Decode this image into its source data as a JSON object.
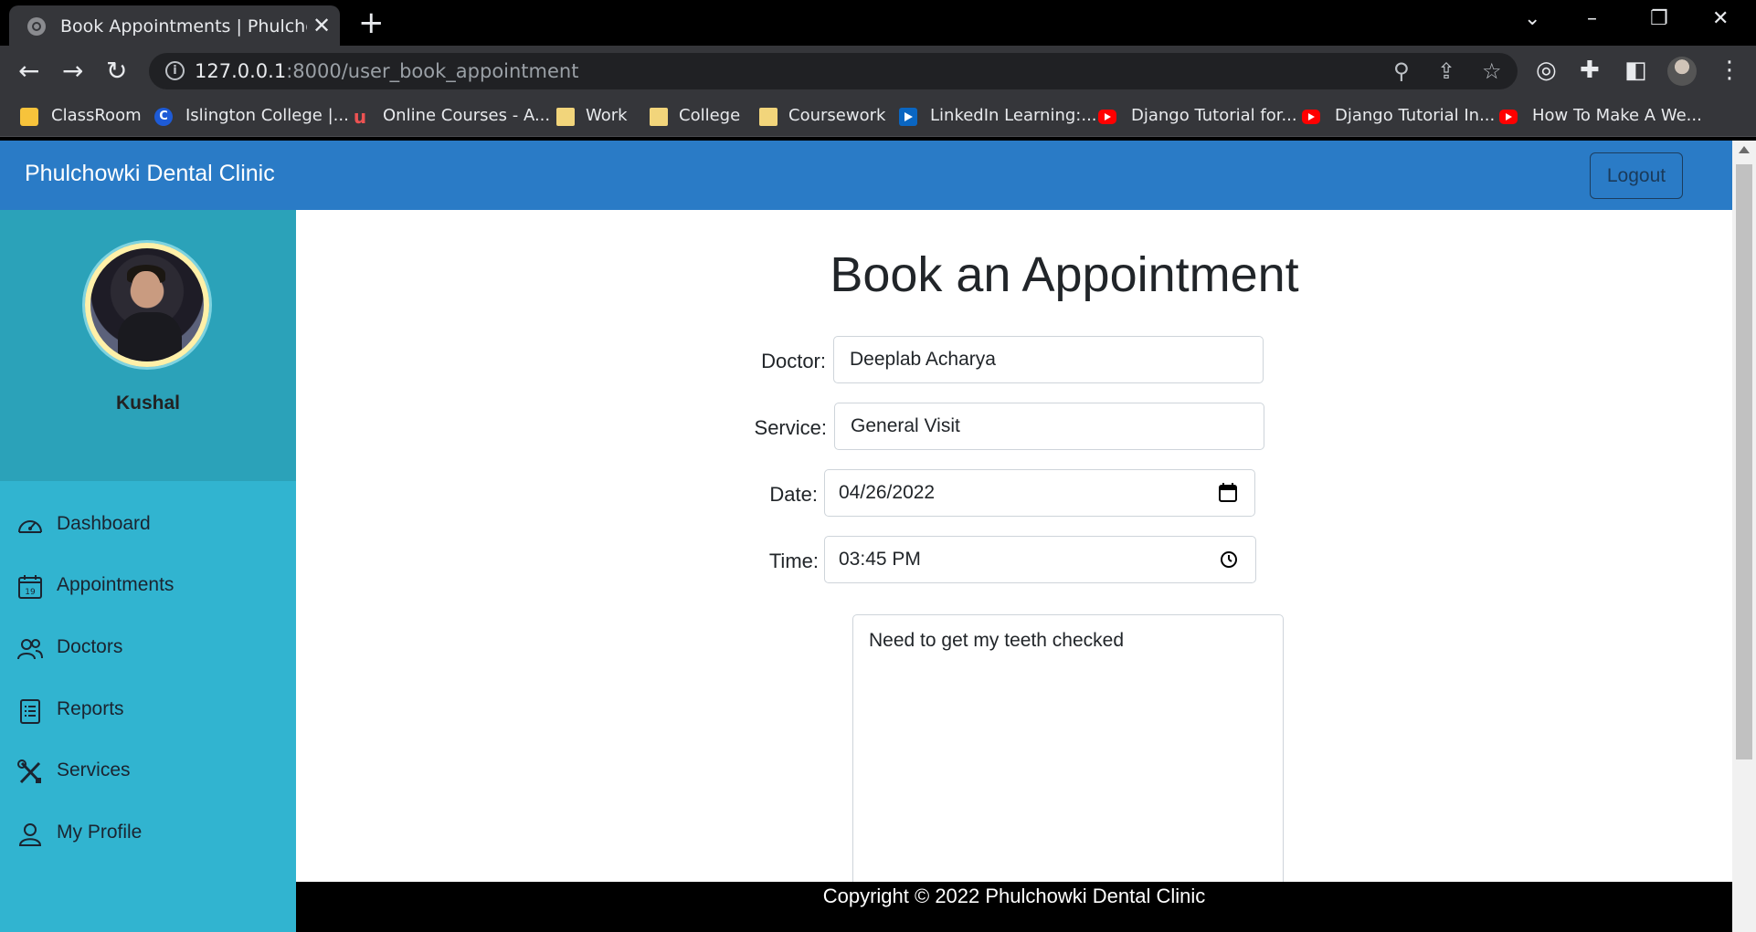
{
  "browser": {
    "tab_title": "Book Appointments | Phulchowki Dental Clinic",
    "url_host": "127.0.0.1",
    "url_path": ":8000/user_book_appointment",
    "bookmarks": [
      {
        "label": "ClassRoom",
        "icon": "classroom-icon"
      },
      {
        "label": "Islington College |...",
        "icon": "islington-icon"
      },
      {
        "label": "Online Courses - A...",
        "icon": "udemy-icon"
      },
      {
        "label": "Work",
        "icon": "folder-icon"
      },
      {
        "label": "College",
        "icon": "folder-icon"
      },
      {
        "label": "Coursework",
        "icon": "folder-icon"
      },
      {
        "label": "LinkedIn Learning:...",
        "icon": "linkedin-learning-icon"
      },
      {
        "label": "Django Tutorial for...",
        "icon": "youtube-icon"
      },
      {
        "label": "Django Tutorial In...",
        "icon": "youtube-icon"
      },
      {
        "label": "How To Make A We...",
        "icon": "youtube-icon"
      }
    ]
  },
  "navbar": {
    "brand": "Phulchowki Dental Clinic",
    "logout_label": "Logout"
  },
  "sidebar": {
    "username": "Kushal",
    "items": [
      {
        "label": "Dashboard",
        "icon": "speedometer-icon"
      },
      {
        "label": "Appointments",
        "icon": "calendar-icon"
      },
      {
        "label": "Doctors",
        "icon": "people-icon"
      },
      {
        "label": "Reports",
        "icon": "report-icon"
      },
      {
        "label": "Services",
        "icon": "tools-icon"
      },
      {
        "label": "My Profile",
        "icon": "person-icon"
      }
    ]
  },
  "form": {
    "heading": "Book an Appointment",
    "doctor_label": "Doctor:",
    "doctor_value": "Deeplab Acharya",
    "service_label": "Service:",
    "service_value": "General Visit",
    "date_label": "Date:",
    "date_value": "04/26/2022",
    "time_label": "Time:",
    "time_value": "03:45 PM",
    "message_value": "Need to get my teeth checked"
  },
  "footer": {
    "text": "Copyright © 2022 Phulchowki Dental Clinic"
  }
}
